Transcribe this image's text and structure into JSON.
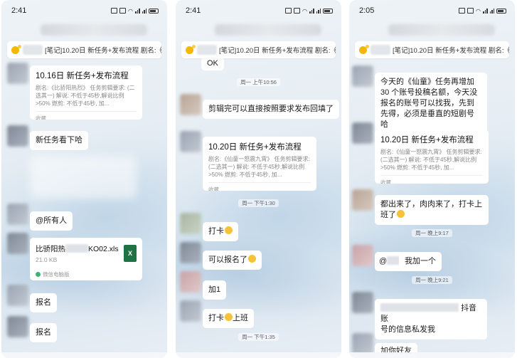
{
  "pinned_text": "[笔记]10.20日 新任务+发布流程 剧名:《...",
  "phones": [
    {
      "time": "2:41",
      "messages": {
        "card1_title": "10.16日 新任务+发布流程",
        "card1_desc": "剧名:《比骄阳热烈》 任务剪辑要求: (二选其一) 解说: 不低于45秒,解说比例>50% 燃剪: 不低于45秒, 加...",
        "card1_foot": "收藏",
        "msg_new_task": "新任务看下哈",
        "msg_at_all": "@所有人",
        "file_name_prefix": "比骄阳热",
        "file_name_suffix": "KO02.xls",
        "file_size": "21.0 KB",
        "file_source": "微信电脑版",
        "file_icon": "X",
        "msg_signup1": "报名",
        "msg_signup2": "报名"
      }
    },
    {
      "time": "2:41",
      "messages": {
        "top_partial": "OK",
        "ts1": "周一 上午10:56",
        "msg_edit_done": "剪辑完可以直接按照要求发布回填了",
        "card_title": "10.20日 新任务+发布流程",
        "card_desc": "剧名:《仙童一怒震九霄》 任务剪辑要求: (二选其一) 解说: 不低于45秒,解说比例>50% 燃剪: 不低于45秒, 加...",
        "card_foot": "收藏",
        "ts2": "周一 下午1:30",
        "msg_checkin": "打卡",
        "msg_can_signup": "可以报名了",
        "msg_plus1": "加1",
        "msg_checkin_work": "打卡",
        "msg_checkin_work_suffix": "上班",
        "ts3": "周一 下午1:35"
      }
    },
    {
      "time": "2:05",
      "messages": {
        "msg_long": "今天的《仙童》任务再增加 30 个账号投稿名额，今天没报名的账号可以找我，先到先得，必须是垂直的短剧号哈",
        "card_title": "10.20日 新任务+发布流程",
        "card_desc": "剧名:《仙童一怒震九霄》 任务剪辑要求: (二选其一) 解说: 不低于45秒,解说比例>50% 燃剪: 不低于45秒, 加...",
        "card_foot": "收藏",
        "msg_all_here": "都出来了，肉肉来了，打卡上班了",
        "ts1": "周一 晚上9:17",
        "msg_at_prefix": "@",
        "msg_me_too": "我加一个",
        "ts2": "周一 晚上9:21",
        "msg_douyin_suffix": "抖音账",
        "msg_douyin_line2": "号的信息私发我",
        "msg_bottom_partial": "加你好友"
      }
    }
  ],
  "colors": {
    "file_icon": "#1f7244",
    "pin_icon": "#f5b800"
  }
}
